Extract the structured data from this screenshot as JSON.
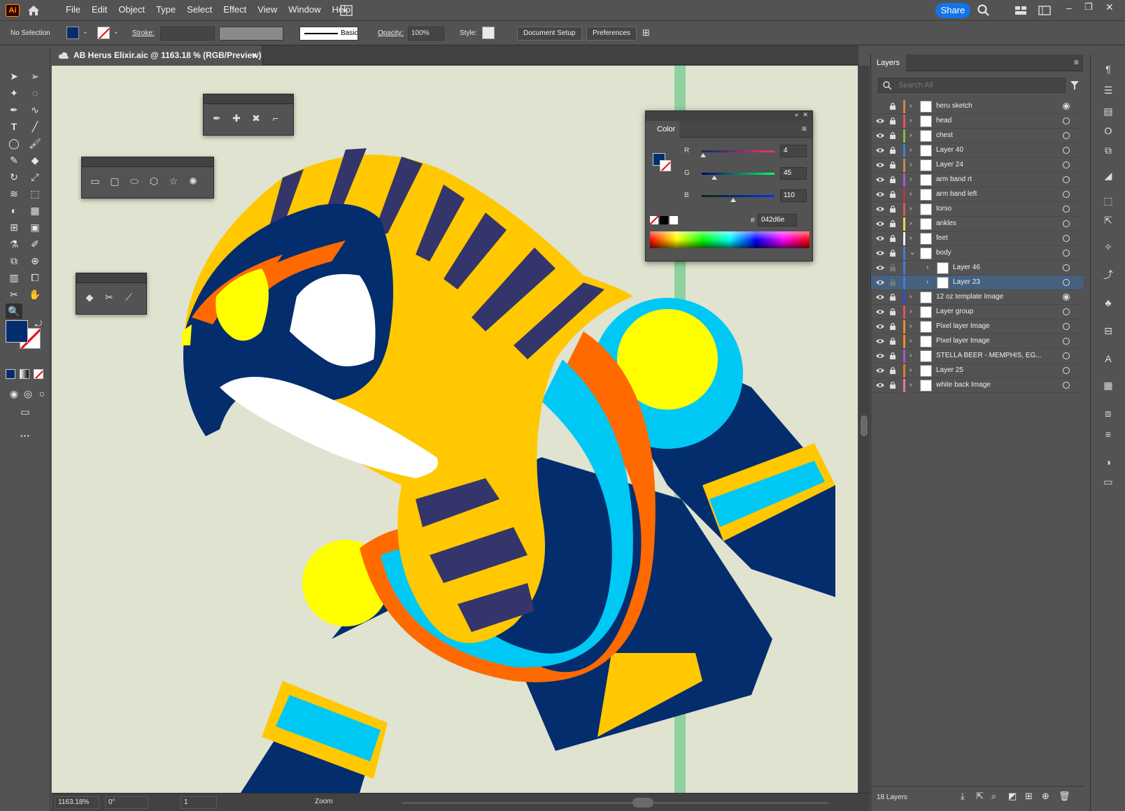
{
  "menubar": {
    "app_logo": "Ai",
    "items": [
      "File",
      "Edit",
      "Object",
      "Type",
      "Select",
      "Effect",
      "View",
      "Window",
      "Help"
    ],
    "share_label": "Share"
  },
  "control_bar": {
    "selection_state": "No Selection",
    "stroke_label": "Stroke:",
    "brush_style": "Basic",
    "opacity_label": "Opacity:",
    "opacity_value": "100%",
    "style_label": "Style:",
    "document_setup": "Document Setup",
    "preferences": "Preferences"
  },
  "document": {
    "tab_title": "AB Herus Elixir.aic @ 1163.18 % (RGB/Preview)",
    "close_glyph": "×"
  },
  "status_bar": {
    "zoom": "1163.18%",
    "rotation": "0°",
    "artboard": "1",
    "mode": "Zoom"
  },
  "color_panel": {
    "title": "Color",
    "r_label": "R",
    "r_value": "4",
    "r_fraction": 0.016,
    "g_label": "G",
    "g_value": "45",
    "g_fraction": 0.176,
    "b_label": "B",
    "b_value": "110",
    "b_fraction": 0.431,
    "hex_label": "#",
    "hex_value": "042d6e",
    "fill_color": "#042d6e"
  },
  "layers_panel": {
    "tab": "Layers",
    "search_placeholder": "Search All",
    "count_label": "18 Layers",
    "layers": [
      {
        "name": "heru sketch",
        "color": "#c98a4a",
        "eye": false,
        "target": "filled",
        "indent": 0,
        "open": false
      },
      {
        "name": "head",
        "color": "#e05555",
        "eye": true,
        "target": "empty",
        "indent": 0,
        "open": false
      },
      {
        "name": "chest",
        "color": "#7bc043",
        "eye": true,
        "target": "empty",
        "indent": 0,
        "open": false
      },
      {
        "name": "Layer 40",
        "color": "#3f7fd9",
        "eye": true,
        "target": "empty",
        "indent": 0,
        "open": false
      },
      {
        "name": "Layer 24",
        "color": "#c98a4a",
        "eye": true,
        "target": "empty",
        "indent": 0,
        "open": false
      },
      {
        "name": "arm band rt",
        "color": "#a05bd1",
        "eye": true,
        "target": "empty",
        "indent": 0,
        "open": false
      },
      {
        "name": "arm band left",
        "color": "#b23a3a",
        "eye": true,
        "target": "empty",
        "indent": 0,
        "open": false
      },
      {
        "name": "torso",
        "color": "#e05555",
        "eye": true,
        "target": "empty",
        "indent": 0,
        "open": false
      },
      {
        "name": "ankles",
        "color": "#e8d84a",
        "eye": true,
        "target": "empty",
        "indent": 0,
        "open": false
      },
      {
        "name": "feet",
        "color": "#f0f0f0",
        "eye": true,
        "target": "empty",
        "indent": 0,
        "open": false
      },
      {
        "name": "body",
        "color": "#3f7fd9",
        "eye": true,
        "target": "empty",
        "indent": 0,
        "open": true
      },
      {
        "name": "Layer 46",
        "color": "#3f7fd9",
        "eye": true,
        "target": "empty",
        "indent": 1,
        "open": false
      },
      {
        "name": "Layer 23",
        "color": "#3f7fd9",
        "eye": true,
        "target": "empty",
        "indent": 1,
        "open": false,
        "selected": true
      },
      {
        "name": "12 oz template Image",
        "color": "#2a4fd1",
        "eye": true,
        "target": "filled",
        "indent": 0,
        "open": false
      },
      {
        "name": "Layer group",
        "color": "#e05555",
        "eye": true,
        "target": "empty",
        "indent": 0,
        "open": false
      },
      {
        "name": "Pixel layer Image",
        "color": "#f08a2a",
        "eye": true,
        "target": "empty",
        "indent": 0,
        "open": false
      },
      {
        "name": "Pixel layer Image",
        "color": "#f08a2a",
        "eye": true,
        "target": "empty",
        "indent": 0,
        "open": false
      },
      {
        "name": "STELLA BEER - MEMPHIS, EG...",
        "color": "#9a5bd1",
        "eye": true,
        "target": "empty",
        "indent": 0,
        "open": false
      },
      {
        "name": "Layer 25",
        "color": "#e07a2a",
        "eye": true,
        "target": "empty",
        "indent": 0,
        "open": false
      },
      {
        "name": "white back Image",
        "color": "#e07aa8",
        "eye": true,
        "target": "empty",
        "indent": 0,
        "open": false
      }
    ]
  },
  "colors": {
    "navy": "#042d6e",
    "gold": "#ffc800",
    "yellow": "#ffff00",
    "cyan": "#00c8f5",
    "orange": "#ff6a00",
    "purple": "#34356a",
    "canvas_bg": "#e0e3cf",
    "guide": "#8fd19e"
  }
}
